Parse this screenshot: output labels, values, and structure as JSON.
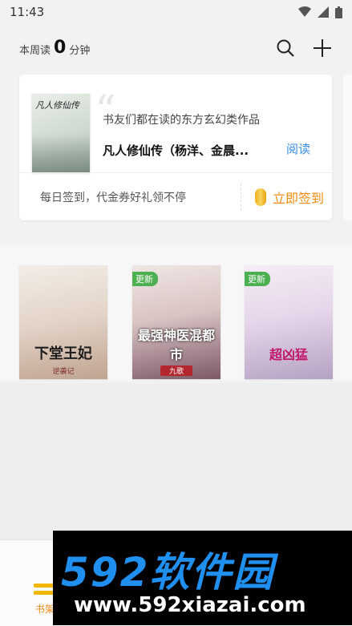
{
  "status_bar": {
    "time": "11:43",
    "icons": [
      "wifi-icon",
      "signal-icon",
      "battery-icon"
    ]
  },
  "header": {
    "reading_prefix": "本周读",
    "reading_minutes": "0",
    "reading_suffix": "分钟",
    "actions": [
      "search-icon",
      "add-icon"
    ]
  },
  "recommend": {
    "cover_title": "凡人修仙传",
    "description": "书友们都在读的东方玄幻类作品",
    "book_title": "凡人修仙传（杨洋、金晨...",
    "read_label": "阅读",
    "signin_text": "每日签到，代金券好礼领不停",
    "signin_button": "立即签到"
  },
  "shelf": {
    "books": [
      {
        "title": "下堂王妃",
        "author": "逆袭记",
        "badge": ""
      },
      {
        "title": "最强神医混都市",
        "author": "九歌",
        "badge": "更新"
      },
      {
        "title": "超凶猛",
        "author": "",
        "badge": "更新"
      }
    ]
  },
  "tabbar": {
    "tabs": [
      {
        "label": "书架",
        "active": true
      }
    ]
  },
  "watermark": {
    "main": "592软件园",
    "url": "www.592xiazai.com"
  },
  "colors": {
    "accent": "#f08a10",
    "link": "#3a8ee6",
    "badge": "#4caf50"
  }
}
